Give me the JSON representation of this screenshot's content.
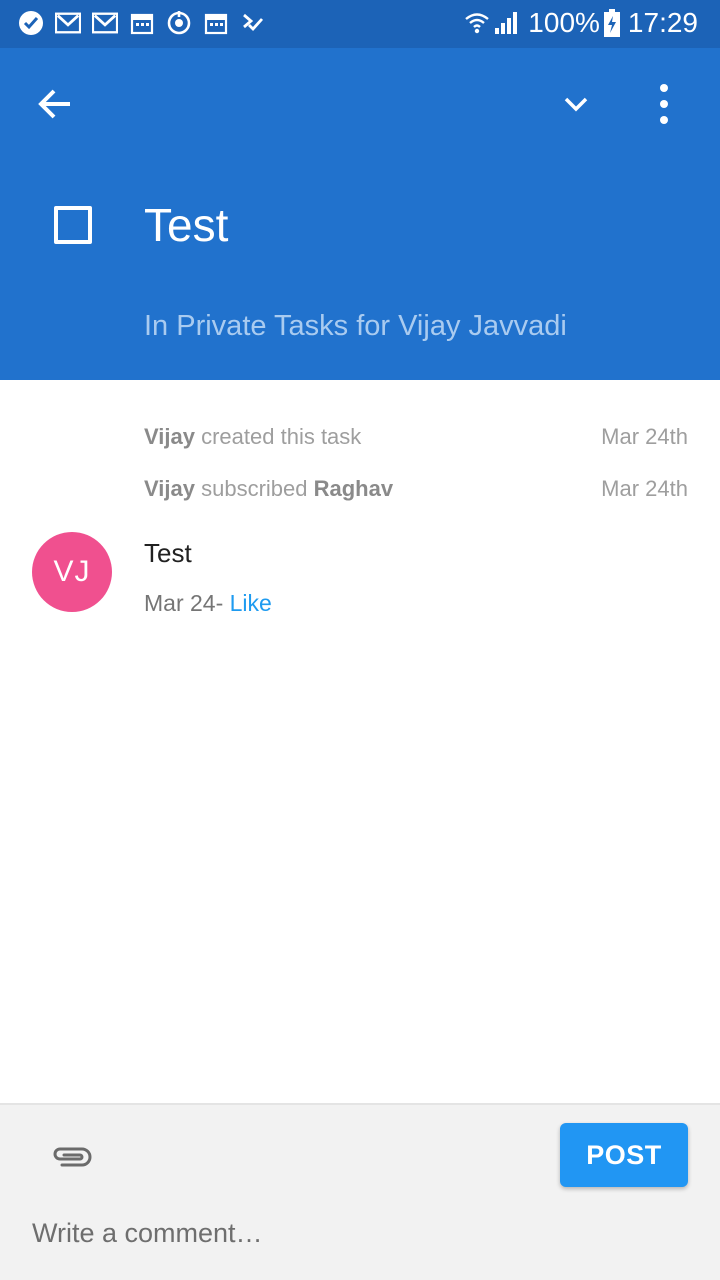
{
  "status_bar": {
    "battery": "100%",
    "time": "17:29",
    "notification_icons": [
      "check-circle-icon",
      "gmail-icon",
      "gmail-icon",
      "calendar-icon",
      "sync-icon",
      "calendar-icon",
      "task-check-icon"
    ],
    "status_icons": [
      "wifi-icon",
      "signal-icon",
      "battery-charging-icon"
    ]
  },
  "app_bar": {
    "back_icon": "arrow-back-icon",
    "expand_icon": "chevron-down-icon",
    "more_icon": "more-vert-icon",
    "task_title": "Test",
    "task_project": "In Private Tasks for Vijay Javvadi",
    "completed": false
  },
  "activity": [
    {
      "actor": "Vijay",
      "action": "created this task",
      "target": "",
      "date": "Mar 24th"
    },
    {
      "actor": "Vijay",
      "action": "subscribed",
      "target": "Raghav",
      "date": "Mar 24th"
    }
  ],
  "comment": {
    "avatar_initials": "VJ",
    "text": "Test",
    "date": "Mar 24-",
    "like_label": "Like"
  },
  "composer": {
    "attach_icon": "paperclip-icon",
    "post_label": "POST",
    "placeholder": "Write a comment…"
  },
  "colors": {
    "status_bar": "#1c63b7",
    "app_bar": "#2172cd",
    "avatar": "#f0508f",
    "accent": "#2196f3",
    "like_link": "#1e9bf0"
  }
}
